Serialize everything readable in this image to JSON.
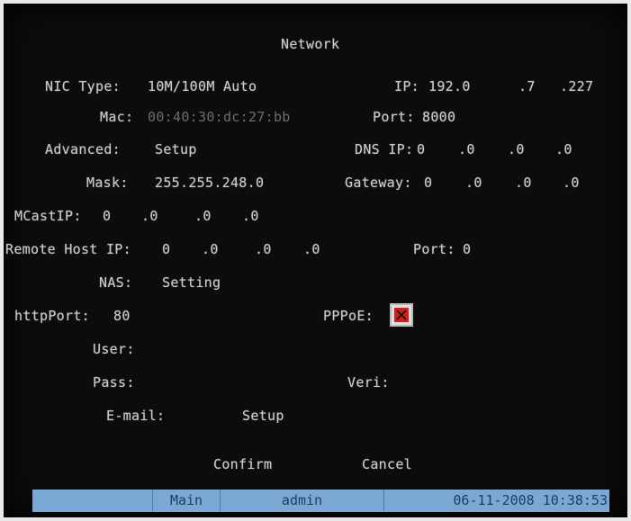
{
  "title": "Network",
  "nic": {
    "label": "NIC Type:",
    "value": "10M/100M Auto"
  },
  "ip": {
    "label": "IP:",
    "octets": [
      "192.0",
      ".7",
      ".227"
    ]
  },
  "mac": {
    "label": "Mac:",
    "value": "00:40:30:dc:27:bb"
  },
  "port": {
    "label": "Port:",
    "value": "8000"
  },
  "advanced": {
    "label": "Advanced:",
    "value": "Setup"
  },
  "dns": {
    "label": "DNS IP:",
    "octets": [
      "0",
      ".0",
      ".0",
      ".0"
    ]
  },
  "mask": {
    "label": "Mask:",
    "value": "255.255.248.0"
  },
  "gateway": {
    "label": "Gateway:",
    "octets": [
      "0",
      ".0",
      ".0",
      ".0"
    ]
  },
  "mcast": {
    "label": "MCastIP:",
    "octets": [
      "0",
      ".0",
      ".0",
      ".0"
    ]
  },
  "remote_host": {
    "label": "Remote Host IP:",
    "octets": [
      "0",
      ".0",
      ".0",
      ".0"
    ],
    "port_label": "Port:",
    "port_value": "0"
  },
  "nas": {
    "label": "NAS:",
    "value": "Setting"
  },
  "http_port": {
    "label": "httpPort:",
    "value": "80"
  },
  "pppoe": {
    "label": "PPPoE:",
    "checked": false
  },
  "user": {
    "label": "User:",
    "value": ""
  },
  "pass": {
    "label": "Pass:",
    "value": ""
  },
  "veri": {
    "label": "Veri:",
    "value": ""
  },
  "email": {
    "label": "E-mail:",
    "value": "Setup"
  },
  "buttons": {
    "confirm": "Confirm",
    "cancel": "Cancel"
  },
  "status_bar": {
    "menu": "Main",
    "user": "admin",
    "datetime": "06-11-2008 10:38:53"
  },
  "colors": {
    "background": "#0c0c0c",
    "text": "#c9c9c9",
    "status_bar": "#7ba7d4",
    "checkbox_mark": "#d41e1e"
  }
}
